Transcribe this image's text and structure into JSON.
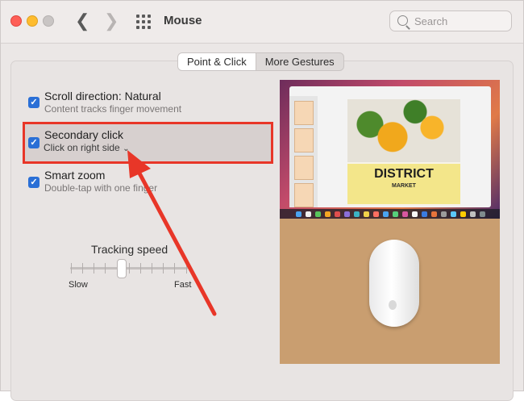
{
  "window": {
    "title": "Mouse",
    "search_placeholder": "Search"
  },
  "tabs": [
    {
      "label": "Point & Click",
      "active": true
    },
    {
      "label": "More Gestures",
      "active": false
    }
  ],
  "options": {
    "scroll_direction": {
      "title": "Scroll direction: Natural",
      "subtitle": "Content tracks finger movement",
      "checked": true
    },
    "secondary_click": {
      "title": "Secondary click",
      "subtitle": "Click on right side",
      "checked": true
    },
    "smart_zoom": {
      "title": "Smart zoom",
      "subtitle": "Double-tap with one finger",
      "checked": true
    }
  },
  "tracking_speed": {
    "label": "Tracking speed",
    "min_label": "Slow",
    "max_label": "Fast",
    "level": 0.45
  },
  "preview": {
    "doc_title": "DISTRICT",
    "doc_subtitle": "MARKET"
  },
  "colors": {
    "accent": "#2a6fd6",
    "highlight": "#e83628"
  },
  "icons": {
    "back": "chevron-left-icon",
    "forward": "chevron-right-icon",
    "show_all": "grid-icon",
    "search": "search-icon",
    "checkbox": "check-icon"
  }
}
